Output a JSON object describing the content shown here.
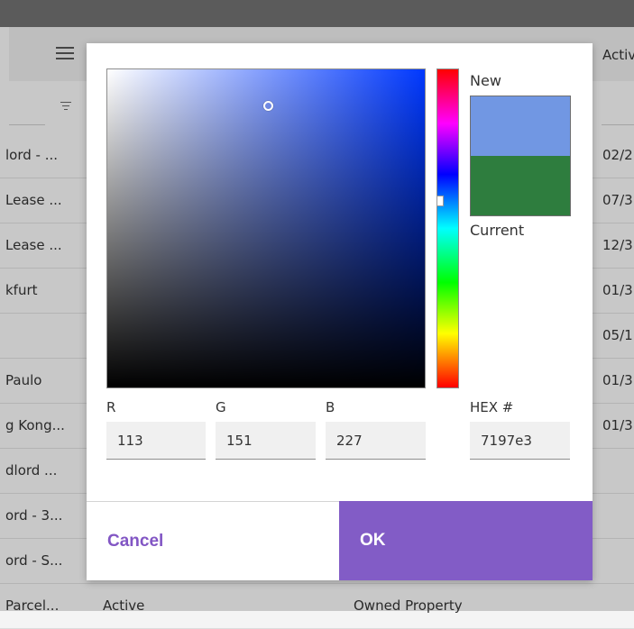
{
  "background": {
    "column_header_right": "Activ",
    "rows": [
      {
        "left": "lord - ...",
        "right": "02/2"
      },
      {
        "left": "Lease ...",
        "right": "07/3"
      },
      {
        "left": "Lease ...",
        "right": "12/3"
      },
      {
        "left": "kfurt",
        "right": "01/3"
      },
      {
        "left": "",
        "right": "05/1"
      },
      {
        "left": "Paulo",
        "right": "01/3"
      },
      {
        "left": "g Kong...",
        "right": "01/3"
      },
      {
        "left": "dlord ...",
        "right": ""
      },
      {
        "left": "ord - 3...",
        "right": ""
      },
      {
        "left": "ord - S...",
        "right": ""
      }
    ],
    "last_row": {
      "left": "Parcel...",
      "status": "Active",
      "type": "Owned Property"
    }
  },
  "color_picker": {
    "new_label": "New",
    "current_label": "Current",
    "new_color": "#7197e3",
    "current_color": "#2e7d3e",
    "hue_color": "#0038ff",
    "r_label": "R",
    "g_label": "G",
    "b_label": "B",
    "hex_label": "HEX #",
    "r_value": "113",
    "g_value": "151",
    "b_value": "227",
    "hex_value": "7197e3"
  },
  "buttons": {
    "cancel_label": "Cancel",
    "ok_label": "OK"
  },
  "colors": {
    "accent": "#825cc6",
    "cancel_text": "#8256c4"
  }
}
